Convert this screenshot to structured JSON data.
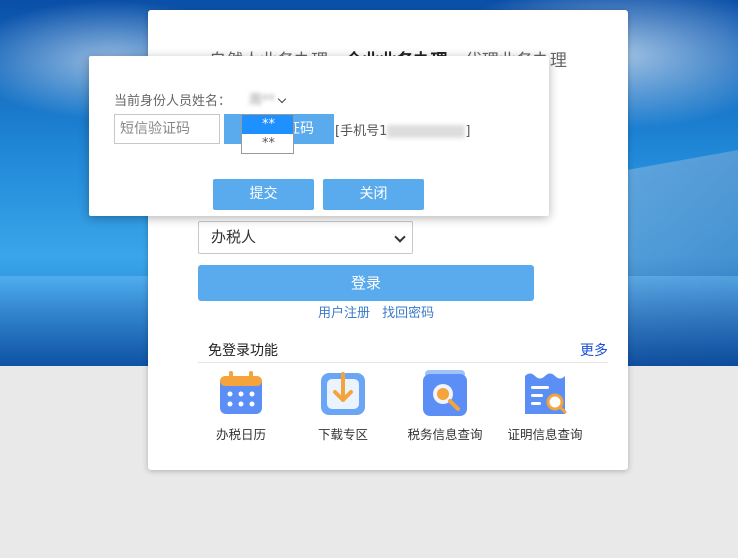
{
  "tabs": [
    "自然人业务办理",
    "企业业务办理",
    "代理业务办理"
  ],
  "active_tab_index": 1,
  "role_select": {
    "value": "办税人"
  },
  "login_button": "登录",
  "links": {
    "register": "用户注册",
    "recover": "找回密码"
  },
  "free_login": {
    "title": "免登录功能",
    "more": "更多",
    "items": [
      {
        "label": "办税日历",
        "icon": "calendar-icon"
      },
      {
        "label": "下载专区",
        "icon": "download-icon"
      },
      {
        "label": "税务信息查询",
        "icon": "search-document-icon"
      },
      {
        "label": "证明信息查询",
        "icon": "certificate-search-icon"
      }
    ]
  },
  "modal": {
    "identity_label": "当前身份人员姓名：",
    "identity_value": "周**",
    "sms_placeholder": "短信验证码",
    "get_code": "获取验证码",
    "phone_prefix": "[手机号1",
    "phone_suffix": "]",
    "dropdown_options": [
      "**",
      "**"
    ],
    "submit": "提交",
    "close": "关闭"
  },
  "colors": {
    "primary": "#5aabed",
    "link": "#3a7ac9",
    "more_link": "#1a4fd6",
    "dropdown_selected": "#1e90ff"
  }
}
